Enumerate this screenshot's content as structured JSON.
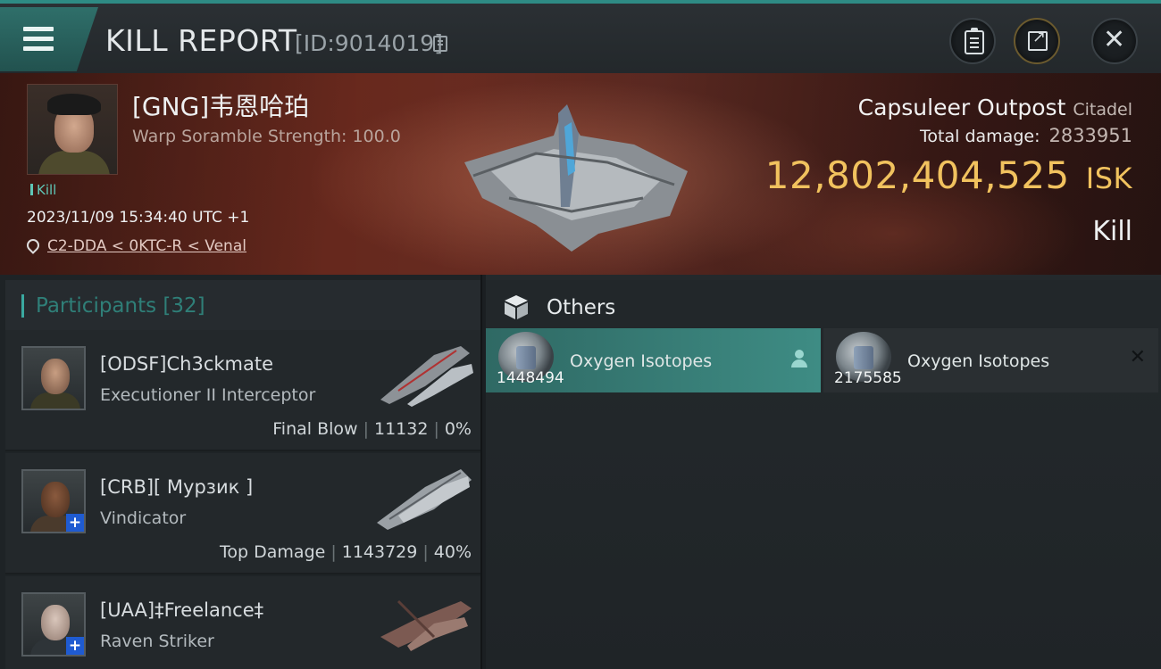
{
  "header": {
    "title": "KILL REPORT",
    "report_id": "[ID:9014019]"
  },
  "victim": {
    "name": "[GNG]韦恩哈珀",
    "subtitle": "Warp Soramble Strength: 100.0",
    "tag": "Kill",
    "timestamp": "2023/11/09 15:34:40 UTC +1",
    "location": "C2-DDA < 0KTC-R < Venal"
  },
  "target": {
    "name": "Capsuleer Outpost",
    "class": "Citadel",
    "total_damage_label": "Total damage:",
    "total_damage_value": "2833951",
    "isk_value": "12,802,404,525",
    "isk_unit": "ISK",
    "result": "Kill"
  },
  "participants": {
    "label": "Participants",
    "count": "[32]",
    "items": [
      {
        "name": "[ODSF]Ch3ckmate",
        "ship": "Executioner II Interceptor",
        "role": "Final Blow",
        "damage": "11132",
        "percent": "0%",
        "plus_badge": false
      },
      {
        "name": "[CRB][ Мурзик ]",
        "ship": "Vindicator",
        "role": "Top Damage",
        "damage": "1143729",
        "percent": "40%",
        "plus_badge": true
      },
      {
        "name": "[UAA]‡Freelance‡",
        "ship": "Raven Striker",
        "role": "",
        "damage": "",
        "percent": "",
        "plus_badge": true
      }
    ]
  },
  "others": {
    "label": "Others",
    "items": [
      {
        "name": "Oxygen Isotopes",
        "quantity": "1448494",
        "icon": "person-icon"
      },
      {
        "name": "Oxygen Isotopes",
        "quantity": "2175585",
        "icon": "x-icon"
      }
    ]
  },
  "colors": {
    "accent": "#3aa9a0",
    "isk_gold": "#f1c25e",
    "hero_red": "#6e2b1f",
    "plus_blue": "#1f5bd1"
  }
}
